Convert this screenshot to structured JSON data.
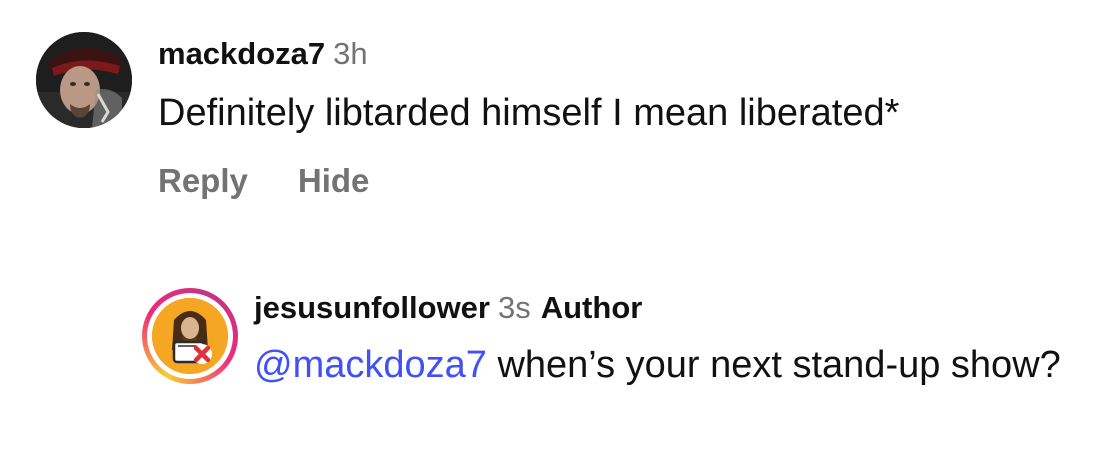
{
  "comments": [
    {
      "username": "mackdoza7",
      "time": "3h",
      "text": "Definitely libtarded himself I mean liberated*",
      "avatar_icon": "user-avatar-photo",
      "actions": {
        "reply_label": "Reply",
        "hide_label": "Hide"
      }
    },
    {
      "username": "jesusunfollower",
      "time": "3s",
      "badge": "Author",
      "mention": "@mackdoza7",
      "text": " when’s your next stand-up show?",
      "avatar_icon": "jesus-unfollow-avatar-icon"
    }
  ],
  "colors": {
    "mention": "#4150f7",
    "muted": "#737373",
    "text": "#111111",
    "story_ring_start": "#f9ce34",
    "story_ring_end": "#ee2a7b",
    "avatar_bg": "#f5a623",
    "x_mark": "#e0313a"
  }
}
